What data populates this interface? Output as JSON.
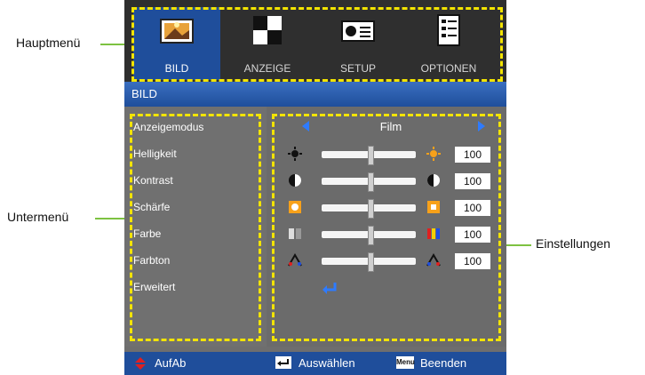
{
  "callouts": {
    "hauptmenu": "Hauptmenü",
    "untermenu": "Untermenü",
    "einstellungen": "Einstellungen"
  },
  "tabs": [
    {
      "label": "BILD",
      "icon": "picture-icon",
      "active": true
    },
    {
      "label": "ANZEIGE",
      "icon": "display-icon",
      "active": false
    },
    {
      "label": "SETUP",
      "icon": "projector-icon",
      "active": false
    },
    {
      "label": "OPTIONEN",
      "icon": "options-icon",
      "active": false
    }
  ],
  "section_title": "BILD",
  "menu_items": [
    {
      "label": "Anzeigemodus"
    },
    {
      "label": "Helligkeit"
    },
    {
      "label": "Kontrast"
    },
    {
      "label": "Schärfe"
    },
    {
      "label": "Farbe"
    },
    {
      "label": "Farbton"
    },
    {
      "label": "Erweitert"
    }
  ],
  "display_mode": {
    "value": "Film"
  },
  "settings": [
    {
      "name": "brightness",
      "value": "100",
      "level": 0.5,
      "icon_left": "sun-small-icon",
      "icon_right": "sun-large-icon"
    },
    {
      "name": "contrast",
      "value": "100",
      "level": 0.5,
      "icon_left": "contrast-dark-icon",
      "icon_right": "contrast-light-icon"
    },
    {
      "name": "sharpness",
      "value": "100",
      "level": 0.5,
      "icon_left": "sharpness-soft-icon",
      "icon_right": "sharpness-sharp-icon"
    },
    {
      "name": "color",
      "value": "100",
      "level": 0.5,
      "icon_left": "color-gray-icon",
      "icon_right": "color-bars-icon"
    },
    {
      "name": "tint",
      "value": "100",
      "level": 0.5,
      "icon_left": "tint-left-icon",
      "icon_right": "tint-right-icon"
    }
  ],
  "footer": {
    "updown": "AufAb",
    "select": "Auswählen",
    "menu_key": "Menu",
    "exit": "Beenden"
  },
  "colors": {
    "accent": "#1f4e9b",
    "highlight": "#f3e400",
    "callout_line": "#7dc241"
  }
}
